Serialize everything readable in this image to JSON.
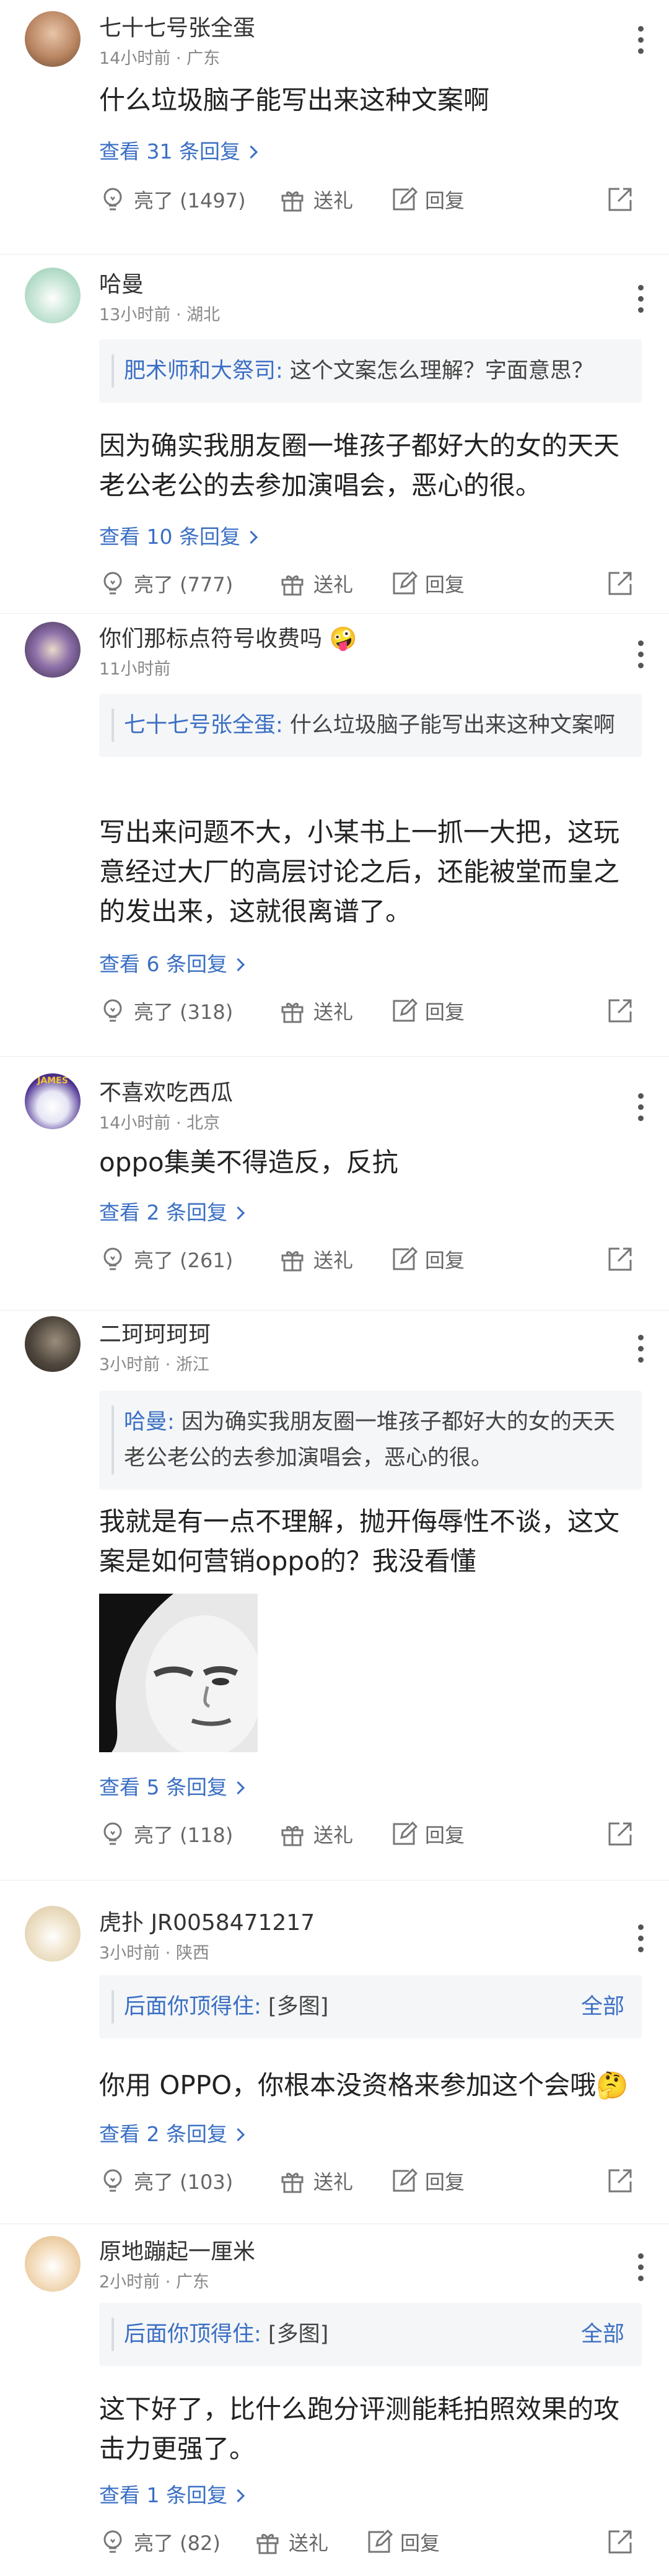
{
  "comments": [
    {
      "username": "七十七号张全蛋",
      "time": "14小时前",
      "location": "广东",
      "text": "什么垃圾脑子能写出来这种文案啊",
      "replies": "查看 31 条回复",
      "likes": "亮了 (1497)",
      "gift": "送礼",
      "reply": "回复"
    },
    {
      "username": "哈曼",
      "time": "13小时前",
      "location": "湖北",
      "quote_author": "肥术师和大祭司:",
      "quote_text": " 这个文案怎么理解？字面意思？",
      "text": "因为确实我朋友圈一堆孩子都好大的女的天天老公老公的去参加演唱会，恶心的很。",
      "replies": "查看 10 条回复",
      "likes": "亮了 (777)",
      "gift": "送礼",
      "reply": "回复"
    },
    {
      "username": "你们那标点符号收费吗 🤪",
      "time": "11小时前",
      "location": "",
      "quote_author": "七十七号张全蛋:",
      "quote_text": " 什么垃圾脑子能写出来这种文案啊",
      "text": "写出来问题不大，小某书上一抓一大把，这玩意经过大厂的高层讨论之后，还能被堂而皇之的发出来，这就很离谱了。",
      "replies": "查看 6 条回复",
      "likes": "亮了 (318)",
      "gift": "送礼",
      "reply": "回复"
    },
    {
      "username": "不喜欢吃西瓜",
      "time": "14小时前",
      "location": "北京",
      "text": "oppo集美不得造反，反抗",
      "replies": "查看 2 条回复",
      "likes": "亮了 (261)",
      "gift": "送礼",
      "reply": "回复",
      "avatar_badge": "JAMES"
    },
    {
      "username": "二珂珂珂珂",
      "time": "3小时前",
      "location": "浙江",
      "quote_author": "哈曼:",
      "quote_text": " 因为确实我朋友圈一堆孩子都好大的女的天天老公老公的去参加演唱会，恶心的很。",
      "text": "我就是有一点不理解，抛开侮辱性不谈，这文案是如何营销oppo的？我没看懂",
      "replies": "查看 5 条回复",
      "likes": "亮了 (118)",
      "gift": "送礼",
      "reply": "回复"
    },
    {
      "username": "虎扑 JR0058471217",
      "time": "3小时前",
      "location": "陕西",
      "quote_author": "后面你顶得住:",
      "quote_text": " [多图]",
      "quote_all": "全部",
      "text": "你用 OPPO，你根本没资格来参加这个会哦🤔",
      "replies": "查看 2 条回复",
      "likes": "亮了 (103)",
      "gift": "送礼",
      "reply": "回复"
    },
    {
      "username": "原地蹦起一厘米",
      "time": "2小时前",
      "location": "广东",
      "quote_author": "后面你顶得住:",
      "quote_text": " [多图]",
      "quote_all": "全部",
      "text": "这下好了，比什么跑分评测能耗拍照效果的攻击力更强了。",
      "replies": "查看 1 条回复",
      "likes": "亮了 (82)",
      "gift": "送礼",
      "reply": "回复"
    }
  ],
  "icons": {
    "like": "lightbulb-icon",
    "gift": "gift-icon",
    "reply": "edit-icon",
    "share": "share-icon",
    "more": "more-vertical-icon"
  },
  "colors": {
    "link": "#3a6fc4",
    "meta": "#888888",
    "quote_bg": "#f5f6f8"
  }
}
